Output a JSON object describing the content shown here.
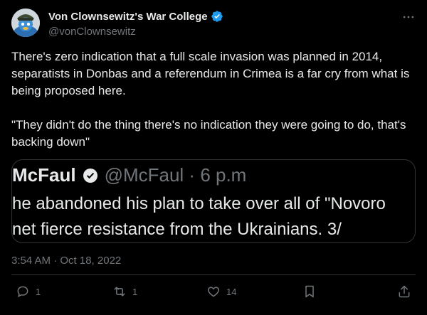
{
  "author": {
    "display_name": "Von Clownsewitz's War College",
    "handle": "@vonClownsewitz"
  },
  "tweet_text": "There's zero indication that a full scale invasion was planned in 2014, separatists in Donbas and a referendum in Crimea is a far cry from what is being proposed here.\n\n\"They didn't do the thing there's no indication they were going to do, that's backing down\"",
  "quoted": {
    "name": "McFaul",
    "meta": "@McFaul · 6 p.m",
    "line1": "he abandoned his plan to take over all of \"Novoro",
    "line2": "net fierce resistance from the Ukrainians. 3/"
  },
  "timestamp": "3:54 AM · Oct 18, 2022",
  "actions": {
    "replies": "1",
    "retweets": "1",
    "likes": "14"
  },
  "colors": {
    "background": "#000000",
    "text": "#e7e9ea",
    "secondary": "#71767b",
    "verified": "#1d9bf0",
    "border": "#2f3336"
  },
  "icons": [
    "avatar-icon",
    "verified-badge-icon",
    "more-icon",
    "reply-icon",
    "retweet-icon",
    "like-icon",
    "bookmark-icon",
    "share-icon"
  ]
}
